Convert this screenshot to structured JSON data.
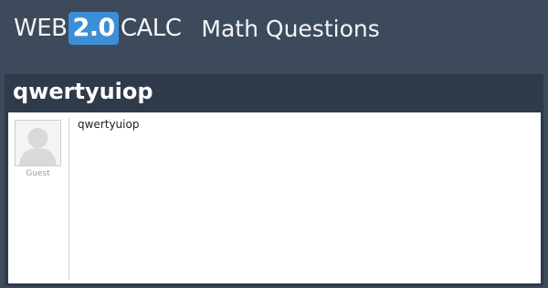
{
  "header": {
    "logo": {
      "part1": "WEB",
      "badge": "2.0",
      "part2": "CALC"
    },
    "section": "Math Questions"
  },
  "question": {
    "title": "qwertyuiop",
    "author": "Guest",
    "body": "qwertyuiop"
  },
  "colors": {
    "background": "#3d4a5c",
    "badge": "#3c8fd6",
    "panel": "#2f3a4a"
  }
}
